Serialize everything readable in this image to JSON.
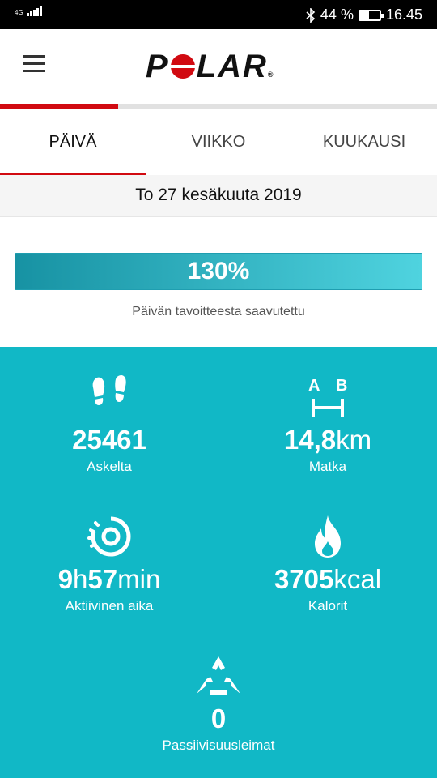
{
  "status_bar": {
    "network": "4G",
    "battery": "44 %",
    "battery_level": 0.44,
    "time": "16.45"
  },
  "header": {
    "logo": "POLAR",
    "page_progress": 0.27
  },
  "tabs": [
    {
      "label": "PÄIVÄ",
      "active": true
    },
    {
      "label": "VIIKKO",
      "active": false
    },
    {
      "label": "KUUKAUSI",
      "active": false
    }
  ],
  "date": "To 27 kesäkuuta 2019",
  "goal": {
    "percent": "130%",
    "caption": "Päivän tavoitteesta saavutettu"
  },
  "stats": {
    "steps": {
      "icon": "footprints-icon",
      "value": "25461",
      "label": "Askelta"
    },
    "distance": {
      "icon": "distance-ab-icon",
      "value": "14,8",
      "unit": "km",
      "label": "Matka"
    },
    "active_time": {
      "icon": "activity-circle-icon",
      "value_h": "9",
      "unit_h": "h",
      "value_m": "57",
      "unit_m": "min",
      "label": "Aktiivinen aika"
    },
    "calories": {
      "icon": "flame-icon",
      "value": "3705",
      "unit": "kcal",
      "label": "Kalorit"
    },
    "inactivity": {
      "icon": "inactivity-triangle-icon",
      "value": "0",
      "label": "Passiivisuusleimat"
    }
  },
  "colors": {
    "accent_red": "#d10a11",
    "stats_bg": "#11b8c6"
  }
}
